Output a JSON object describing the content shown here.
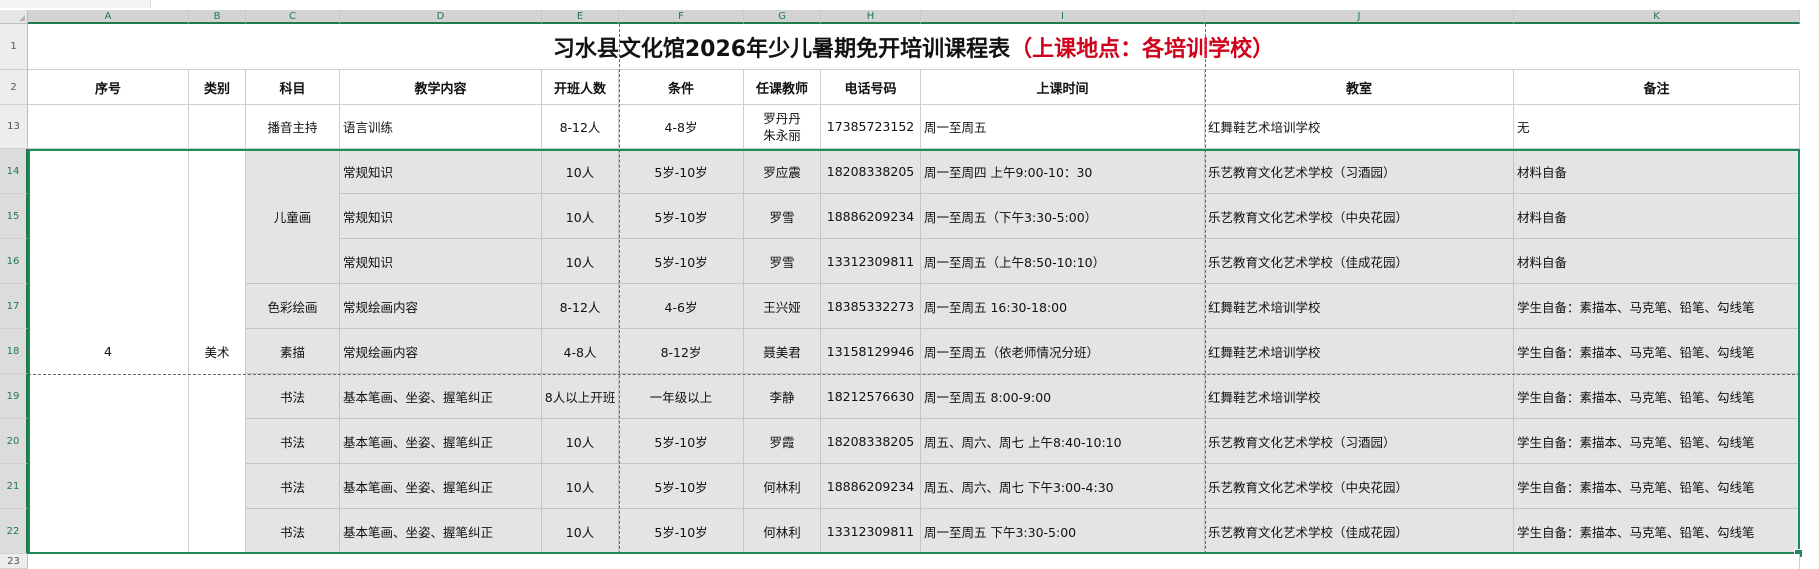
{
  "columns": [
    "A",
    "B",
    "C",
    "D",
    "E",
    "F",
    "G",
    "H",
    "I",
    "J",
    "K"
  ],
  "title": {
    "main": "习水县文化馆2026年少儿暑期免开培训课程表",
    "highlight": "（上课地点：各培训学校）"
  },
  "header_row_number": "2",
  "title_row_number": "1",
  "headers": [
    "序号",
    "类别",
    "科目",
    "教学内容",
    "开班人数",
    "条件",
    "任课教师",
    "电话号码",
    "上课时间",
    "教室",
    "备注"
  ],
  "row13": {
    "row_number": "13",
    "subject": "播音主持",
    "content": "语言训练",
    "class_size": "8-12人",
    "condition": "4-8岁",
    "teacher_1": "罗丹丹",
    "teacher_2": "朱永丽",
    "phone": "17385723152",
    "time": "周一至周五",
    "room": "红舞鞋艺术培训学校",
    "note": "无"
  },
  "merged": {
    "seq": "4",
    "category": "美术",
    "subject_children_painting": "儿童画"
  },
  "rows": [
    {
      "row_number": "14",
      "subject": "",
      "content": "常规知识",
      "class_size": "10人",
      "condition": "5岁-10岁",
      "teacher": "罗应震",
      "phone": "18208338205",
      "time": "周一至周四 上午9:00-10：30",
      "room": "乐艺教育文化艺术学校（习酒园）",
      "note": "材料自备"
    },
    {
      "row_number": "15",
      "subject": "",
      "content": "常规知识",
      "class_size": "10人",
      "condition": "5岁-10岁",
      "teacher": "罗雪",
      "phone": "18886209234",
      "time": "周一至周五（下午3:30-5:00）",
      "room": "乐艺教育文化艺术学校（中央花园）",
      "note": "材料自备"
    },
    {
      "row_number": "16",
      "subject": "",
      "content": "常规知识",
      "class_size": "10人",
      "condition": "5岁-10岁",
      "teacher": "罗雪",
      "phone": "13312309811",
      "time": "周一至周五（上午8:50-10:10）",
      "room": "乐艺教育文化艺术学校（佳成花园）",
      "note": "材料自备"
    },
    {
      "row_number": "17",
      "subject": "色彩绘画",
      "content": "常规绘画内容",
      "class_size": "8-12人",
      "condition": "4-6岁",
      "teacher": "王兴娅",
      "phone": "18385332273",
      "time": "周一至周五 16:30-18:00",
      "room": "红舞鞋艺术培训学校",
      "note": "学生自备：素描本、马克笔、铅笔、勾线笔"
    },
    {
      "row_number": "18",
      "subject": "素描",
      "content": "常规绘画内容",
      "class_size": "4-8人",
      "condition": "8-12岁",
      "teacher": "聂美君",
      "phone": "13158129946",
      "time": "周一至周五（依老师情况分班）",
      "room": "红舞鞋艺术培训学校",
      "note": "学生自备：素描本、马克笔、铅笔、勾线笔"
    },
    {
      "row_number": "19",
      "subject": "书法",
      "content": "基本笔画、坐姿、握笔纠正",
      "class_size": "8人以上开班",
      "condition": "一年级以上",
      "teacher": "李静",
      "phone": "18212576630",
      "time": "周一至周五 8:00-9:00",
      "room": "红舞鞋艺术培训学校",
      "note": "学生自备：素描本、马克笔、铅笔、勾线笔"
    },
    {
      "row_number": "20",
      "subject": "书法",
      "content": "基本笔画、坐姿、握笔纠正",
      "class_size": "10人",
      "condition": "5岁-10岁",
      "teacher": "罗霞",
      "phone": "18208338205",
      "time": "周五、周六、周七 上午8:40-10:10",
      "room": "乐艺教育文化艺术学校（习酒园）",
      "note": "学生自备：素描本、马克笔、铅笔、勾线笔"
    },
    {
      "row_number": "21",
      "subject": "书法",
      "content": "基本笔画、坐姿、握笔纠正",
      "class_size": "10人",
      "condition": "5岁-10岁",
      "teacher": "何林利",
      "phone": "18886209234",
      "time": "周五、周六、周七 下午3:00-4:30",
      "room": "乐艺教育文化艺术学校（中央花园）",
      "note": "学生自备：素描本、马克笔、铅笔、勾线笔"
    },
    {
      "row_number": "22",
      "subject": "书法",
      "content": "基本笔画、坐姿、握笔纠正",
      "class_size": "10人",
      "condition": "5岁-10岁",
      "teacher": "何林利",
      "phone": "13312309811",
      "time": "周一至周五 下午3:30-5:00",
      "room": "乐艺教育文化艺术学校（佳成花园）",
      "note": "学生自备：素描本、马克笔、铅笔、勾线笔"
    }
  ],
  "row23": {
    "row_number": "23"
  },
  "colors": {
    "selection": "#1f8b5b",
    "highlight_text": "#d0021b",
    "shade": "#e4e4e4"
  }
}
